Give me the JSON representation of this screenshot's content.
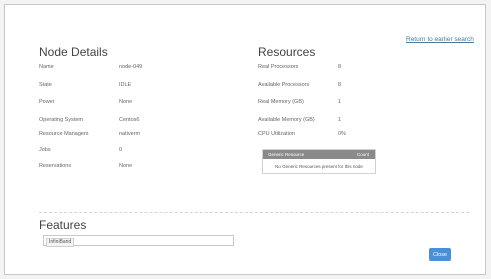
{
  "header": {
    "return_link": "Return to earlier search"
  },
  "node_details": {
    "title": "Node Details",
    "rows": [
      {
        "label": "Name",
        "value": "node-049"
      },
      {
        "label": "State",
        "value": "IDLE"
      },
      {
        "label": "Power",
        "value": "None"
      },
      {
        "label": "Operating System",
        "value": "Centos6"
      },
      {
        "label": "Resource Managers",
        "value": "nativerm"
      },
      {
        "label": "Jobs",
        "value": "0"
      },
      {
        "label": "Reservations",
        "value": "None"
      }
    ]
  },
  "resources": {
    "title": "Resources",
    "rows": [
      {
        "label": "Real Processors",
        "value": "8"
      },
      {
        "label": "Available Processors",
        "value": "8"
      },
      {
        "label": "Real Memory (GB)",
        "value": "1"
      },
      {
        "label": "Available Memory (GB)",
        "value": "1"
      },
      {
        "label": "CPU Utilization",
        "value": "0%"
      }
    ],
    "generic_resources": {
      "col_name": "Generic Resource",
      "col_count": "Count",
      "empty_message": "No Generic Resources present for this node"
    }
  },
  "features": {
    "title": "Features",
    "tags": [
      "InfiniBand"
    ]
  },
  "footer": {
    "close_label": "Close"
  }
}
